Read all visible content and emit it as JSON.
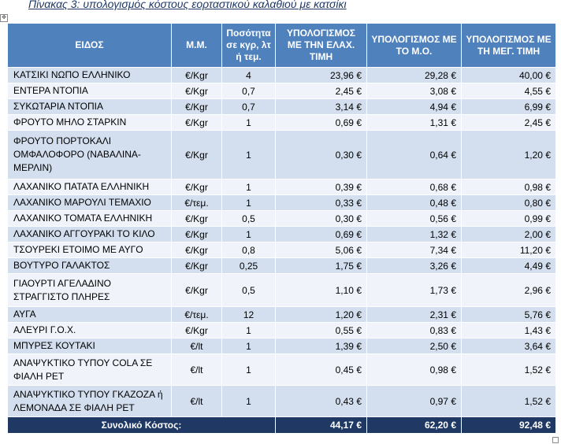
{
  "caption": "Πίνακας 3: υπολογισμός κόστους εορταστικού καλαθιού με κατσίκι",
  "headers": {
    "item": "ΕΙΔΟΣ",
    "unit": "Μ.Μ.",
    "qty": "Ποσότητα σε κγρ, λτ ή τεμ.",
    "min": "ΥΠΟΛΟΓΙΣΜΟΣ ΜΕ ΤΗΝ ΕΛΑΧ. ΤΙΜΗ",
    "avg": "ΥΠΟΛΟΓΙΣΜΟΣ ΜΕ ΤΟ Μ.Ο.",
    "max": "ΥΠΟΛΟΓΙΣΜΟΣ ΜΕ ΤΗ ΜΕΓ. ΤΙΜΗ"
  },
  "rows": [
    {
      "item": "ΚΑΤΣΙΚΙ ΝΩΠΟ ΕΛΛΗΝΙΚΟ",
      "unit": "€/Kgr",
      "qty": "4",
      "min": "23,96 €",
      "avg": "29,28 €",
      "max": "40,00 €"
    },
    {
      "item": "ΕΝΤΕΡΑ ΝΤΟΠΙΑ",
      "unit": "€/Kgr",
      "qty": "0,7",
      "min": "2,45 €",
      "avg": "3,08 €",
      "max": "4,55 €"
    },
    {
      "item": "ΣΥΚΩΤΑΡΙΑ ΝΤΟΠΙΑ",
      "unit": "€/Kgr",
      "qty": "0,7",
      "min": "3,14 €",
      "avg": "4,94 €",
      "max": "6,99 €"
    },
    {
      "item": "ΦΡΟΥΤΟ ΜΗΛΟ ΣΤΑΡΚΙΝ",
      "unit": "€/Kgr",
      "qty": "1",
      "min": "0,69 €",
      "avg": "1,31 €",
      "max": "2,45 €"
    },
    {
      "item": "ΦΡΟΥΤΟ ΠΟΡΤΟΚΑΛΙ ΟΜΦΑΛΟΦΟΡΟ (ΝΑΒΑΛΙΝΑ-ΜΕΡΛΙΝ)",
      "unit": "€/Kgr",
      "qty": "1",
      "min": "0,30 €",
      "avg": "0,64 €",
      "max": "1,20 €"
    },
    {
      "item": "ΛΑΧΑΝΙΚΟ ΠΑΤΑΤΑ ΕΛΛΗΝΙΚΗ",
      "unit": "€/Kgr",
      "qty": "1",
      "min": "0,39 €",
      "avg": "0,68 €",
      "max": "0,98 €"
    },
    {
      "item": "ΛΑΧΑΝΙΚΟ ΜΑΡΟΥΛΙ ΤΕΜΑΧΙΟ",
      "unit": "€/τεμ.",
      "qty": "1",
      "min": "0,33 €",
      "avg": "0,48 €",
      "max": "0,80 €"
    },
    {
      "item": "ΛΑΧΑΝΙΚΟ ΤΟΜΑΤΑ ΕΛΛΗΝΙΚΗ",
      "unit": "€/Kgr",
      "qty": "0,5",
      "min": "0,30 €",
      "avg": "0,56 €",
      "max": "0,99 €"
    },
    {
      "item": "ΛΑΧΑΝΙΚΟ ΑΓΓΟΥΡΑΚΙ ΤΟ ΚΙΛΟ",
      "unit": "€/Kgr",
      "qty": "1",
      "min": "0,69 €",
      "avg": "1,32 €",
      "max": "2,00 €"
    },
    {
      "item": "ΤΣΟΥΡΕΚΙ ΕΤΟΙΜΟ ΜΕ ΑΥΓΟ",
      "unit": "€/Kgr",
      "qty": "0,8",
      "min": "5,06 €",
      "avg": "7,34 €",
      "max": "11,20 €"
    },
    {
      "item": "ΒΟΥΤΥΡΟ ΓΑΛΑΚΤΟΣ",
      "unit": "€/Kgr",
      "qty": "0,25",
      "min": "1,75 €",
      "avg": "3,26 €",
      "max": "4,49 €"
    },
    {
      "item": "ΓΙΑΟΥΡΤΙ ΑΓΕΛΑΔΙΝΟ ΣΤΡΑΓΓΙΣΤΟ ΠΛΗΡΕΣ",
      "unit": "€/Kgr",
      "qty": "0,5",
      "min": "1,10 €",
      "avg": "1,73 €",
      "max": "2,96 €"
    },
    {
      "item": "ΑΥΓΑ",
      "unit": "€/τεμ.",
      "qty": "12",
      "min": "1,20 €",
      "avg": "2,31 €",
      "max": "5,76 €"
    },
    {
      "item": "ΑΛΕΥΡΙ Γ.Ο.Χ.",
      "unit": "€/Kgr",
      "qty": "1",
      "min": "0,55 €",
      "avg": "0,83 €",
      "max": "1,43 €"
    },
    {
      "item": "ΜΠΥΡΕΣ ΚΟΥΤΑΚΙ",
      "unit": "€/lt",
      "qty": "1",
      "min": "1,39 €",
      "avg": "2,50 €",
      "max": "3,64 €"
    },
    {
      "item": "ΑΝΑΨΥΚΤΙΚΟ ΤΥΠΟΥ COLA ΣΕ ΦΙΑΛΗ PET",
      "unit": "€/lt",
      "qty": "1",
      "min": "0,45 €",
      "avg": "0,98 €",
      "max": "1,52 €"
    },
    {
      "item": "ΑΝΑΨΥΚΤΙΚΟ ΤΥΠΟΥ ΓΚΑΖΟΖΑ ή ΛΕΜΟΝΑΔΑ ΣΕ ΦΙΑΛΗ PET",
      "unit": "€/lt",
      "qty": "1",
      "min": "0,43 €",
      "avg": "0,97 €",
      "max": "1,52 €"
    }
  ],
  "total": {
    "label": "Συνολικό Κόστος:",
    "min": "44,17 €",
    "avg": "62,20 €",
    "max": "92,48 €"
  },
  "colors": {
    "header": "#4f81bd",
    "row_odd": "#d3dfee",
    "row_even": "#f0f4fa",
    "total": "#1f3864",
    "caption": "#1f3864"
  }
}
